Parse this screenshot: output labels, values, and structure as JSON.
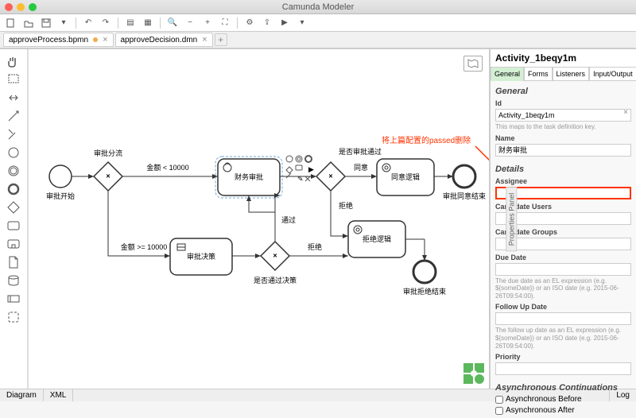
{
  "app": {
    "title": "Camunda Modeler"
  },
  "tabs": [
    {
      "label": "approveProcess.bpmn",
      "dirty": true
    },
    {
      "label": "approveDecision.dmn",
      "dirty": false
    }
  ],
  "palette": [
    "hand",
    "lasso",
    "space",
    "connect-global",
    "connect",
    "start-event",
    "intermediate-event",
    "end-event",
    "gateway",
    "task",
    "subprocess-expand",
    "data-object",
    "data-store",
    "participant",
    "group"
  ],
  "canvas": {
    "nodes": {
      "start": "审批开始",
      "gw1": "审批分流",
      "edge_lt": "金额 < 10000",
      "edge_ge": "金额 >= 10000",
      "task_finance": "财务审批",
      "gw2": "是否审批通过",
      "agree": "同意",
      "reject": "拒绝",
      "task_agree": "同意逻辑",
      "end_agree": "审批同意结束",
      "task_decision": "审批决策",
      "pass": "通过",
      "task_reject_logic": "拒绝逻辑",
      "gw3": "是否通过决策",
      "reject2": "拒绝",
      "end_reject": "审批拒绝结束"
    },
    "annotation": "将上篇配置的passed删除"
  },
  "properties": {
    "title": "Activity_1beqy1m",
    "tabs": [
      "General",
      "Forms",
      "Listeners",
      "Input/Output"
    ],
    "generalHeader": "General",
    "idLabel": "Id",
    "idValue": "Activity_1beqy1m",
    "idHelp": "This maps to the task definition key.",
    "nameLabel": "Name",
    "nameValue": "财务审批",
    "detailsHeader": "Details",
    "assigneeLabel": "Assignee",
    "assigneeValue": "",
    "candUsersLabel": "Candidate Users",
    "candGroupsLabel": "Candidate Groups",
    "dueDateLabel": "Due Date",
    "dueDateHelp": "The due date as an EL expression (e.g. ${someDate}) or an ISO date (e.g. 2015-06-26T09:54:00).",
    "followUpLabel": "Follow Up Date",
    "followUpHelp": "The follow up date as an EL expression (e.g. ${someDate}) or an ISO date (e.g. 2015-06-26T09:54:00).",
    "priorityLabel": "Priority",
    "asyncHeader": "Asynchronous Continuations",
    "asyncBefore": "Asynchronous Before",
    "asyncAfter": "Asynchronous After",
    "handleLabel": "Properties Panel"
  },
  "footer": {
    "diagram": "Diagram",
    "xml": "XML",
    "log": "Log"
  }
}
